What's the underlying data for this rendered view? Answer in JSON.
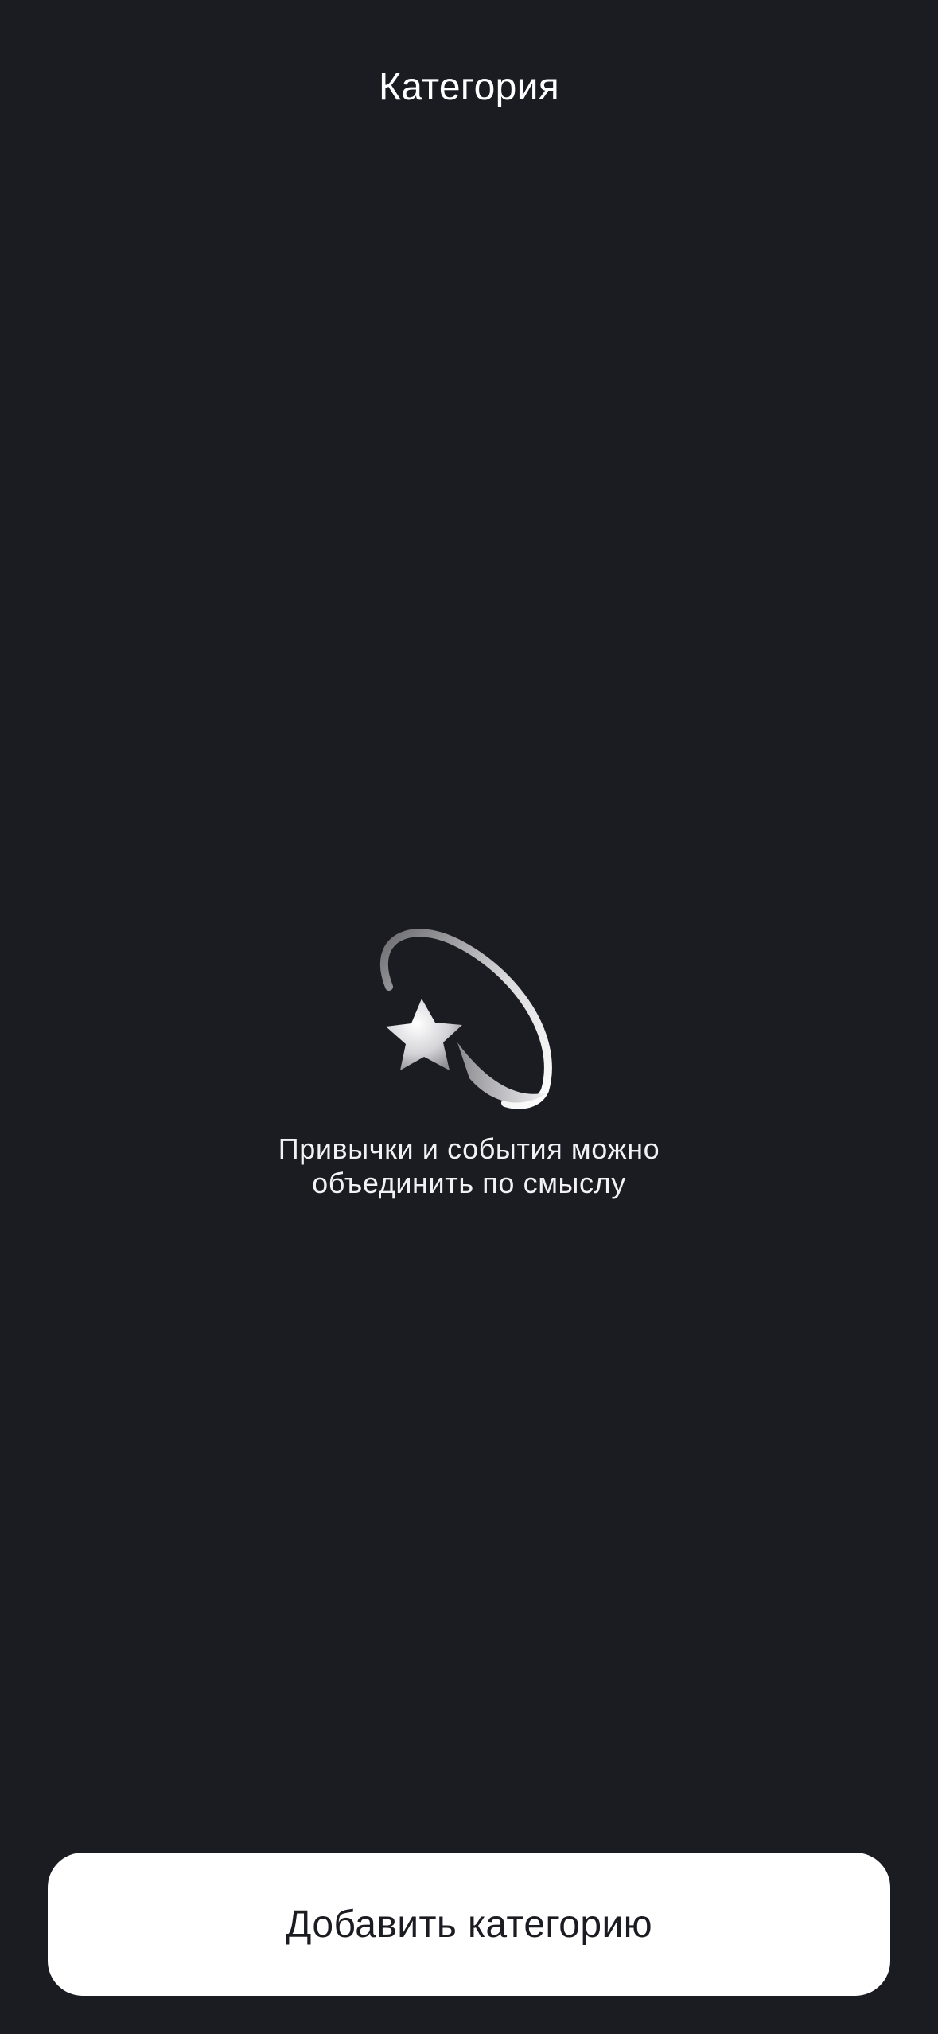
{
  "header": {
    "title": "Категория"
  },
  "empty_state": {
    "icon": "shooting-star-icon",
    "line1": "Привычки и события можно",
    "line2": "объединить по смыслу"
  },
  "footer": {
    "add_button_label": "Добавить категорию"
  },
  "colors": {
    "background": "#1b1b22",
    "button_background": "#ffffff",
    "button_text": "#1b1b22",
    "text": "#ffffff"
  }
}
